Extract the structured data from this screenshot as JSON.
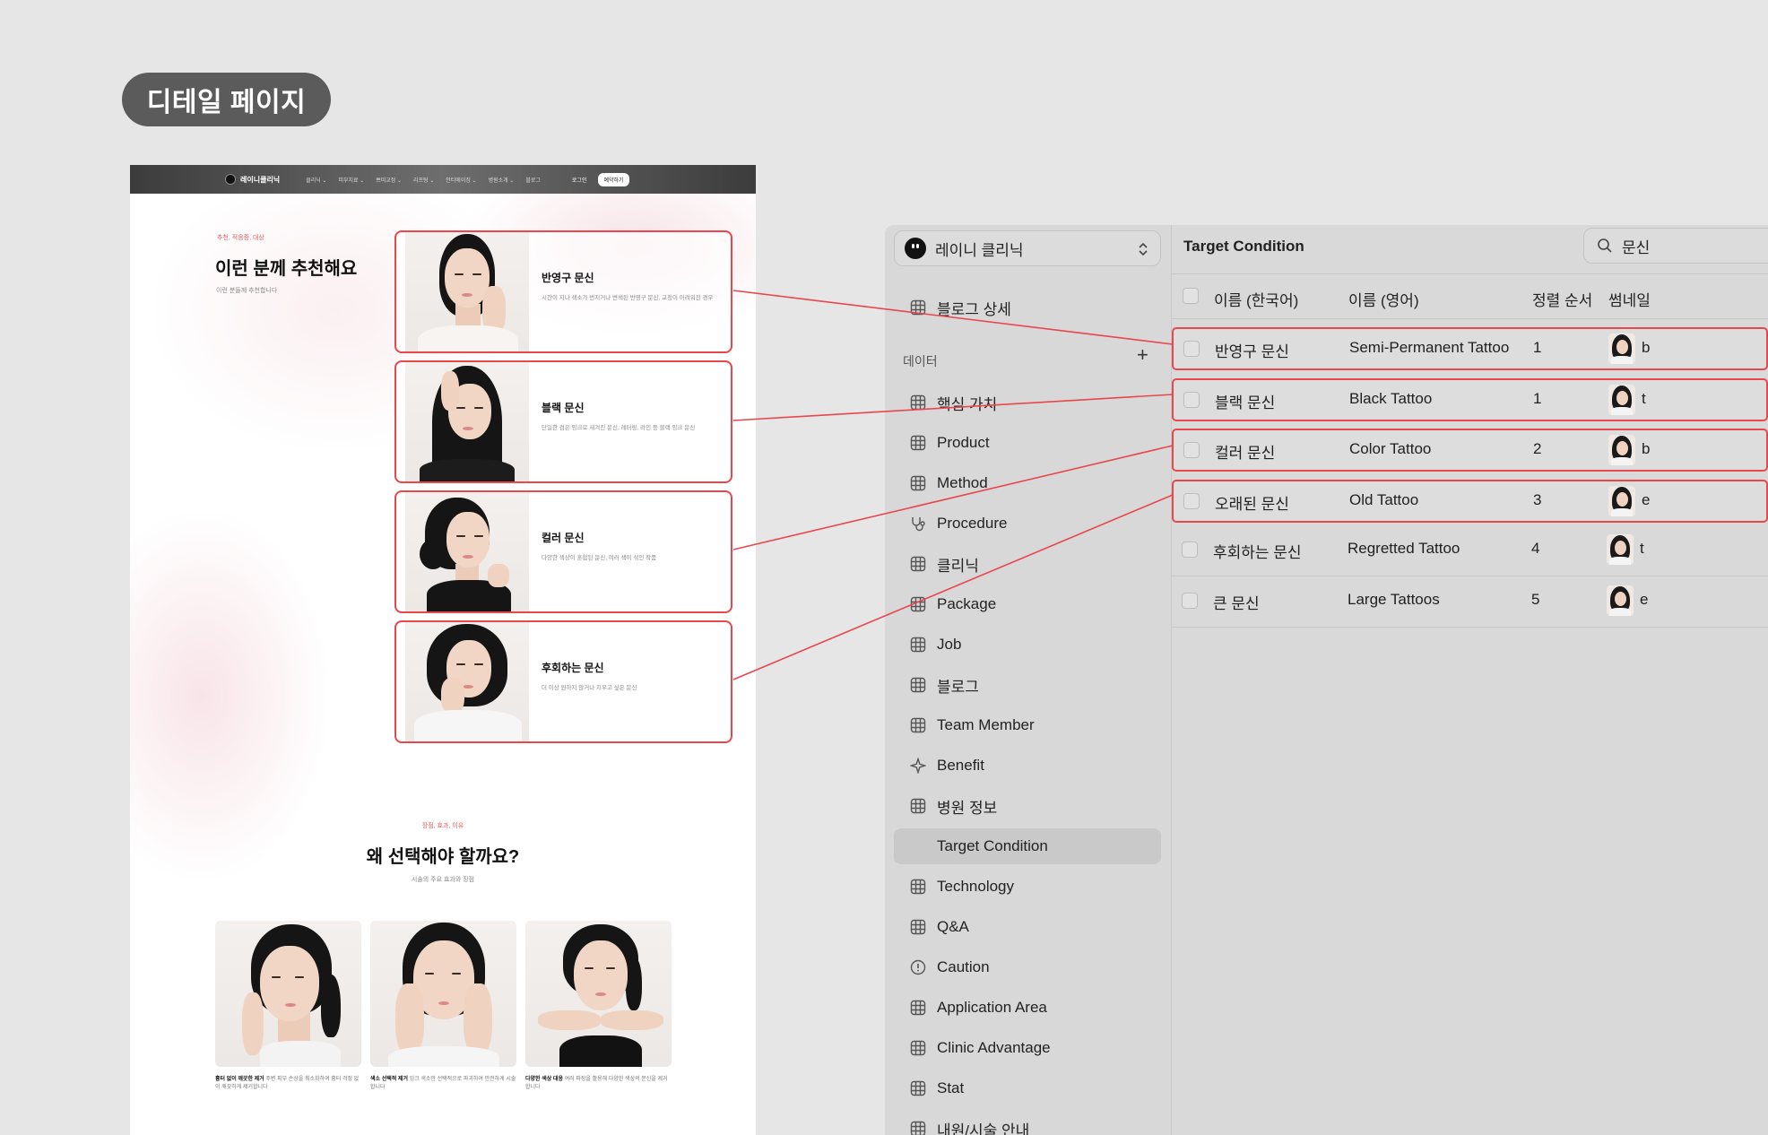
{
  "badge": "디테일 페이지",
  "site": {
    "brand": "레이니클리닉",
    "nav": [
      "클리닉 ⌄",
      "피부치료 ⌄",
      "쁘띠교정 ⌄",
      "리프팅 ⌄",
      "안티에이징 ⌄",
      "병원소개 ⌄",
      "블로그"
    ],
    "login": "로그인",
    "cta": "예약하기",
    "rec_tag": "추천, 적응증, 대상",
    "rec_title": "이런 분께 추천해요",
    "rec_sub": "이런 분들께 추천합니다",
    "cards": [
      {
        "title": "반영구 문신",
        "desc": "시간이 지나 색소가 번지거나 변색된 반영구 문신, 교정이 어려워진 경우"
      },
      {
        "title": "블랙 문신",
        "desc": "단일한 검은 잉크로 새겨진 문신, 레터링, 라인 등 블랙 잉크 문신"
      },
      {
        "title": "컬러 문신",
        "desc": "다양한 색상이 혼합된 문신, 여러 색이 섞인 작품"
      },
      {
        "title": "후회하는 문신",
        "desc": "더 이상 원하지 않거나 지우고 싶은 문신"
      }
    ],
    "why_tag": "장점, 효과, 이유",
    "why_title": "왜 선택해야 할까요?",
    "why_sub": "시술의 주요 효과와 장점",
    "why_cards": [
      {
        "title": "흉터 없이 깨끗한 제거",
        "desc": "주변 피부 손상을 최소화하여 흉터 걱정 없이 깨끗하게 제거합니다"
      },
      {
        "title": "색소 선택적 제거",
        "desc": "잉크 색소만 선택적으로 파괴하여 안전하게 시술합니다"
      },
      {
        "title": "다양한 색상 대응",
        "desc": "여러 파장을 활용해 다양한 색상의 문신을 제거합니다"
      }
    ]
  },
  "cms": {
    "project": "레이니 클리닉",
    "top_item": "블로그 상세",
    "section_label": "데이터",
    "section_add": "+",
    "sidebar_items": [
      {
        "label": "핵심 가치",
        "icon": "grid-icon"
      },
      {
        "label": "Product",
        "icon": "grid-icon"
      },
      {
        "label": "Method",
        "icon": "grid-icon"
      },
      {
        "label": "Procedure",
        "icon": "stethoscope-icon"
      },
      {
        "label": "클리닉",
        "icon": "grid-icon"
      },
      {
        "label": "Package",
        "icon": "grid-icon"
      },
      {
        "label": "Job",
        "icon": "grid-icon"
      },
      {
        "label": "블로그",
        "icon": "grid-icon"
      },
      {
        "label": "Team Member",
        "icon": "grid-icon"
      },
      {
        "label": "Benefit",
        "icon": "sparkle-icon"
      },
      {
        "label": "병원 정보",
        "icon": "grid-icon"
      },
      {
        "label": "Target Condition",
        "icon": "none"
      },
      {
        "label": "Technology",
        "icon": "grid-icon"
      },
      {
        "label": "Q&A",
        "icon": "grid-icon"
      },
      {
        "label": "Caution",
        "icon": "alert-circle-icon"
      },
      {
        "label": "Application Area",
        "icon": "grid-icon"
      },
      {
        "label": "Clinic Advantage",
        "icon": "grid-icon"
      },
      {
        "label": "Stat",
        "icon": "grid-icon"
      },
      {
        "label": "내원/시술 안내",
        "icon": "grid-icon"
      }
    ],
    "title": "Target Condition",
    "search_value": "문신",
    "columns": [
      "이름 (한국어)",
      "이름 (영어)",
      "정렬 순서",
      "썸네일"
    ],
    "rows": [
      {
        "ko": "반영구 문신",
        "en": "Semi-Permanent Tattoo",
        "order": "1",
        "trail": "b"
      },
      {
        "ko": "블랙 문신",
        "en": "Black Tattoo",
        "order": "1",
        "trail": "t"
      },
      {
        "ko": "컬러 문신",
        "en": "Color Tattoo",
        "order": "2",
        "trail": "b"
      },
      {
        "ko": "오래된 문신",
        "en": "Old Tattoo",
        "order": "3",
        "trail": "e"
      },
      {
        "ko": "후회하는 문신",
        "en": "Regretted Tattoo",
        "order": "4",
        "trail": "t"
      },
      {
        "ko": "큰 문신",
        "en": "Large Tattoos",
        "order": "5",
        "trail": "e"
      }
    ],
    "highlight_color": "#e8474c"
  }
}
